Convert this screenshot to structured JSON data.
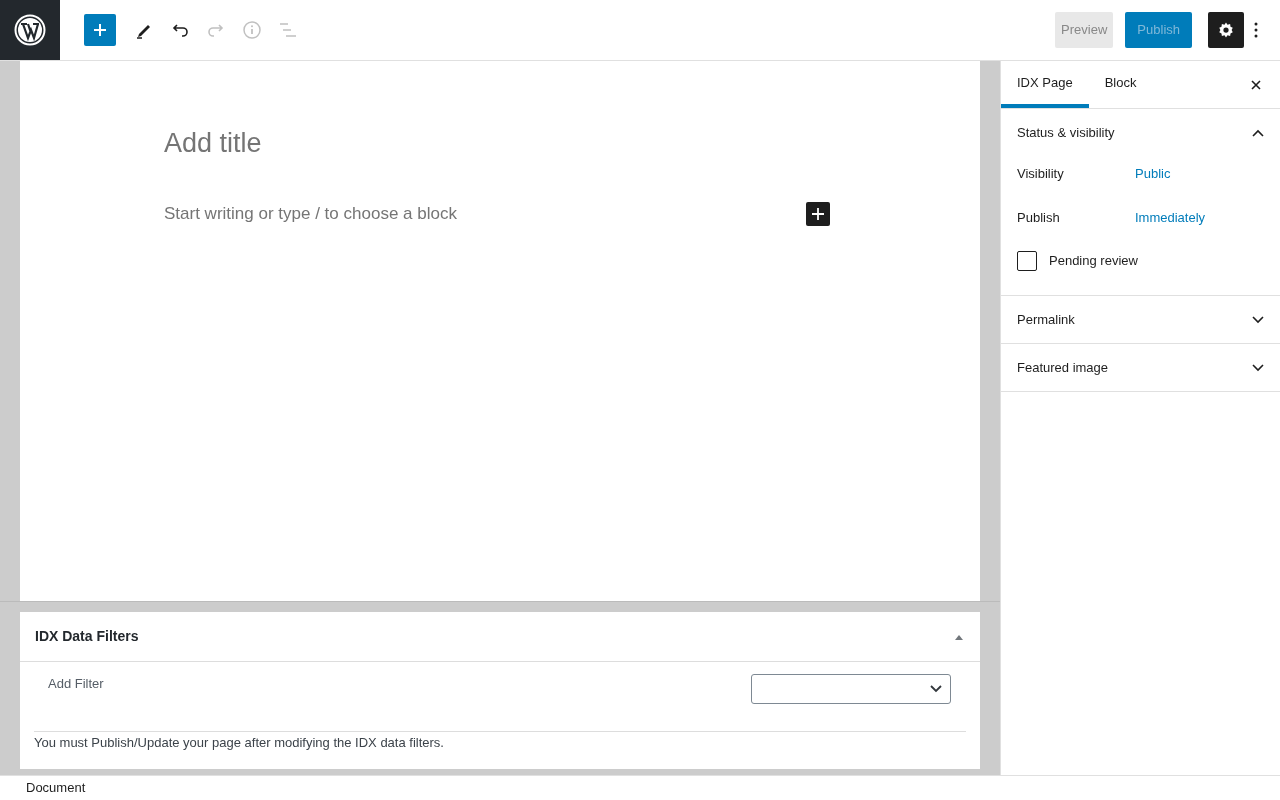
{
  "toolbar": {
    "tools": [
      {
        "kind": "add",
        "disabled": false
      },
      {
        "kind": "edit",
        "disabled": false
      },
      {
        "kind": "undo",
        "disabled": false
      },
      {
        "kind": "redo",
        "disabled": true
      },
      {
        "kind": "info",
        "disabled": true
      },
      {
        "kind": "outline",
        "disabled": true
      }
    ],
    "preview": {
      "label": "Preview"
    },
    "publish": {
      "label": "Publish"
    },
    "settings": {
      "pressed": true
    }
  },
  "editor": {
    "title_placeholder": "Add title",
    "block_placeholder": "Start writing or type / to choose a block"
  },
  "metabox": {
    "title": "IDX Data Filters",
    "expanded": true,
    "filter_label": "Add Filter",
    "notice": "You must Publish/Update your page after modifying the IDX data filters."
  },
  "sidebar": {
    "tabs": [
      {
        "label": "IDX Page",
        "selected": true
      },
      {
        "label": "Block",
        "selected": false
      }
    ],
    "panels": [
      {
        "title": "Status & visibility",
        "expanded": true,
        "rows": [
          {
            "kind": "link",
            "label": "Visibility",
            "value": "Public"
          },
          {
            "kind": "link",
            "label": "Publish",
            "value": "Immediately"
          },
          {
            "kind": "checkbox",
            "label": "Pending review",
            "checked": false
          }
        ]
      },
      {
        "title": "Permalink",
        "expanded": false
      },
      {
        "title": "Featured image",
        "expanded": false
      }
    ]
  },
  "footer": {
    "breadcrumb": "Document"
  }
}
